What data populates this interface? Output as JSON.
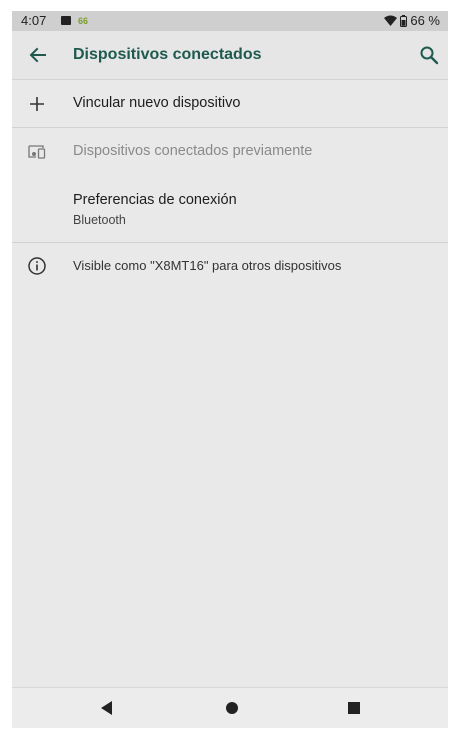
{
  "status_bar": {
    "time": "4:07",
    "notification_badge": "66",
    "battery": "66 %"
  },
  "app_bar": {
    "title": "Dispositivos conectados"
  },
  "items": [
    {
      "label": "Vincular nuevo dispositivo",
      "icon": "plus-icon"
    },
    {
      "label": "Dispositivos conectados previamente",
      "icon": "devices-icon"
    },
    {
      "label": "Preferencias de conexión",
      "sublabel": "Bluetooth"
    }
  ],
  "info": {
    "text": "Visible como \"X8MT16\" para otros dispositivos",
    "icon": "info-icon"
  },
  "colors": {
    "accent": "#1f5a4e",
    "background": "#e9e9e9",
    "disabled_text": "#8a8a8a"
  }
}
